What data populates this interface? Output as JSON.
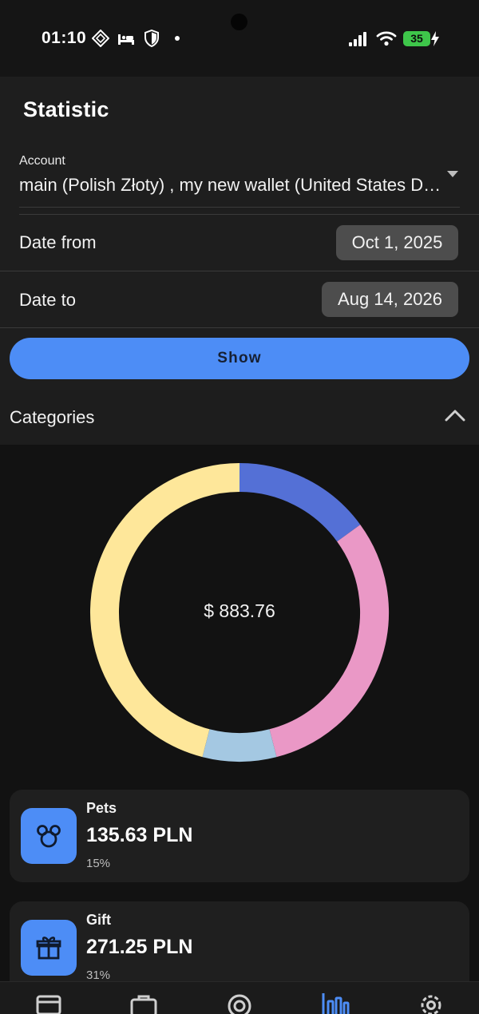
{
  "status_bar": {
    "time": "01:10",
    "battery_level": "35",
    "icons": [
      "ai-sparkle-icon",
      "bed-icon",
      "shield-icon",
      "dot-icon",
      "signal-icon",
      "wifi-icon",
      "battery-icon",
      "charging-icon"
    ]
  },
  "header": {
    "title": "Statistic"
  },
  "filters": {
    "account_label": "Account",
    "account_value": "main (Polish Złoty) , my new wallet (United States Dollar)",
    "date_from_label": "Date from",
    "date_from_value": "Oct 1, 2025",
    "date_to_label": "Date to",
    "date_to_value": "Aug 14, 2026",
    "show_label": "Show"
  },
  "categories": {
    "title": "Categories",
    "total": "$ 883.76",
    "chart_data": {
      "type": "pie",
      "donut": true,
      "slices": [
        {
          "color": "#5470d6",
          "fraction": 0.15
        },
        {
          "color": "#ea98c6",
          "fraction": 0.31
        },
        {
          "color": "#a4c8e2",
          "fraction": 0.08
        },
        {
          "color": "#fee79a",
          "fraction": 0.46
        }
      ]
    },
    "items": [
      {
        "name": "Pets",
        "amount": "135.63 PLN",
        "percent": "15%",
        "icon": "pets-icon"
      },
      {
        "name": "Gift",
        "amount": "271.25 PLN",
        "percent": "31%",
        "icon": "gift-icon"
      }
    ]
  },
  "bottom_nav": {
    "items": [
      "wallet-icon",
      "briefcase-icon",
      "target-icon",
      "stats-icon",
      "settings-icon"
    ],
    "active": "stats-icon"
  },
  "colors": {
    "accent": "#4d8df6",
    "background": "#121212",
    "surface": "#1e1e1e",
    "chip": "#4d4d4d"
  }
}
